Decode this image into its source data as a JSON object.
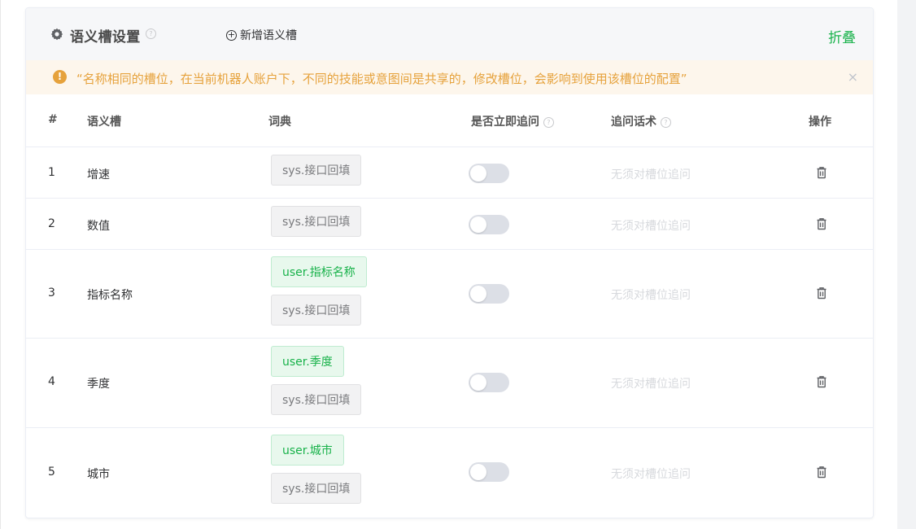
{
  "header": {
    "title": "语义槽设置",
    "help": "?",
    "add_button": "新增语义槽",
    "add_icon": "+",
    "collapse_button": "折叠"
  },
  "notice": {
    "icon": "!",
    "text": "“名称相同的槽位，在当前机器人账户下，不同的技能或意图间是共享的，修改槽位，会影响到使用该槽位的配置”",
    "close": "×"
  },
  "table": {
    "columns": {
      "index": "#",
      "slot": "语义槽",
      "dict": "词典",
      "ask_now": "是否立即追问",
      "followup": "追问话术",
      "action": "操作"
    },
    "help": "?",
    "rows": [
      {
        "index": "1",
        "slot": "增速",
        "dicts": [
          "sys.接口回填"
        ],
        "ask_now": false,
        "followup": "无须对槽位追问"
      },
      {
        "index": "2",
        "slot": "数值",
        "dicts": [
          "sys.接口回填"
        ],
        "ask_now": false,
        "followup": "无须对槽位追问"
      },
      {
        "index": "3",
        "slot": "指标名称",
        "dicts": [
          "user.指标名称",
          "sys.接口回填"
        ],
        "ask_now": false,
        "followup": "无须对槽位追问"
      },
      {
        "index": "4",
        "slot": "季度",
        "dicts": [
          "user.季度",
          "sys.接口回填"
        ],
        "ask_now": false,
        "followup": "无须对槽位追问"
      },
      {
        "index": "5",
        "slot": "城市",
        "dicts": [
          "user.城市",
          "sys.接口回填"
        ],
        "ask_now": false,
        "followup": "无须对槽位追问"
      }
    ]
  },
  "colors": {
    "accent": "#18b24a",
    "warning": "#e6a23c",
    "notice_bg": "#fdf6ec"
  },
  "icons": {
    "header": "gear-icon",
    "add": "plus-circle-icon",
    "notice": "exclamation-circle-icon",
    "close": "close-icon",
    "delete": "trash-icon",
    "help": "question-circle-icon"
  }
}
